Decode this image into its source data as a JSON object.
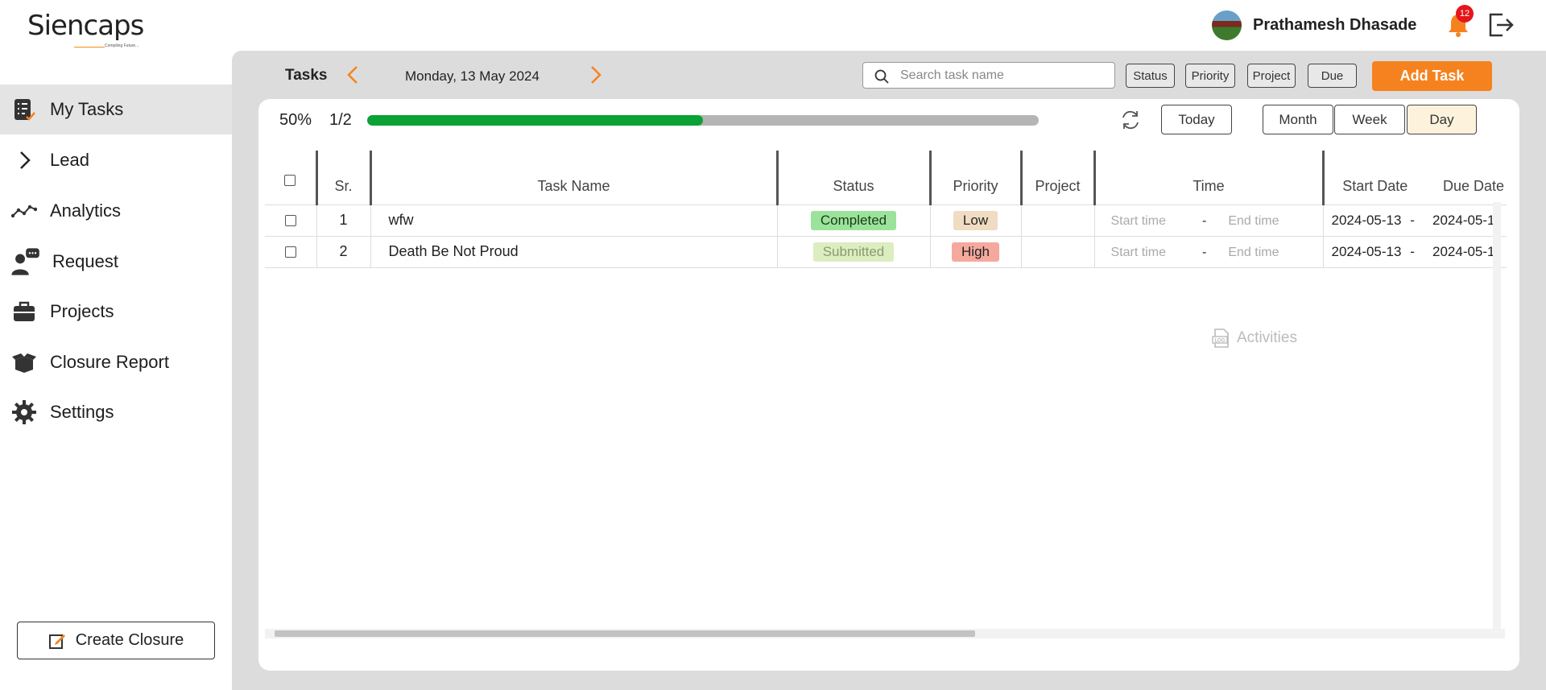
{
  "brand": {
    "name": "Siencaps",
    "logo_text": "Siencaps",
    "tagline": "Compiling Future..."
  },
  "user": {
    "name": "Prathamesh Dhasade",
    "notifications": "12"
  },
  "sidebar": {
    "items": [
      {
        "label": "My Tasks",
        "icon": "task-list-icon",
        "active": true
      },
      {
        "label": "Lead",
        "icon": "chevron-right-icon",
        "active": false
      },
      {
        "label": "Analytics",
        "icon": "analytics-line-icon",
        "active": false
      },
      {
        "label": "Request",
        "icon": "request-person-icon",
        "active": false
      },
      {
        "label": "Projects",
        "icon": "briefcase-icon",
        "active": false
      },
      {
        "label": "Closure Report",
        "icon": "open-box-icon",
        "active": false
      },
      {
        "label": "Settings",
        "icon": "gear-icon",
        "active": false
      }
    ],
    "create_closure": "Create Closure"
  },
  "toolbar": {
    "tasks_label": "Tasks",
    "date": "Monday, 13 May 2024",
    "search_placeholder": "Search task name",
    "filters": [
      "Status",
      "Priority",
      "Project",
      "Due"
    ],
    "add_task": "Add Task"
  },
  "progress": {
    "percent_label": "50%",
    "count_label": "1/2",
    "fraction": 0.5
  },
  "views": {
    "today": "Today",
    "month": "Month",
    "week": "Week",
    "day": "Day",
    "active": "Day"
  },
  "table": {
    "columns": [
      "Sr.",
      "Task Name",
      "Status",
      "Priority",
      "Project",
      "Time",
      "Start Date",
      "Due Date"
    ],
    "rows": [
      {
        "sr": "1",
        "name": "wfw",
        "status": "Completed",
        "priority": "Low",
        "project": "",
        "start_time": "Start time",
        "dash": "-",
        "end_time": "End time",
        "start_date": "2024-05-13",
        "date_sep": "-",
        "due_date": "2024-05-1"
      },
      {
        "sr": "2",
        "name": "Death Be Not Proud",
        "status": "Submitted",
        "priority": "High",
        "project": "",
        "start_time": "Start time",
        "dash": "-",
        "end_time": "End time",
        "start_date": "2024-05-13",
        "date_sep": "-",
        "due_date": "2024-05-1"
      }
    ]
  },
  "activities": "Activities",
  "colors": {
    "accent": "#f6821f",
    "progress": "#0aa135",
    "status_completed_bg": "#9be39b",
    "status_submitted_bg": "#dcedc0",
    "priority_low_bg": "#f0dcc2",
    "priority_high_bg": "#f5a99d"
  }
}
